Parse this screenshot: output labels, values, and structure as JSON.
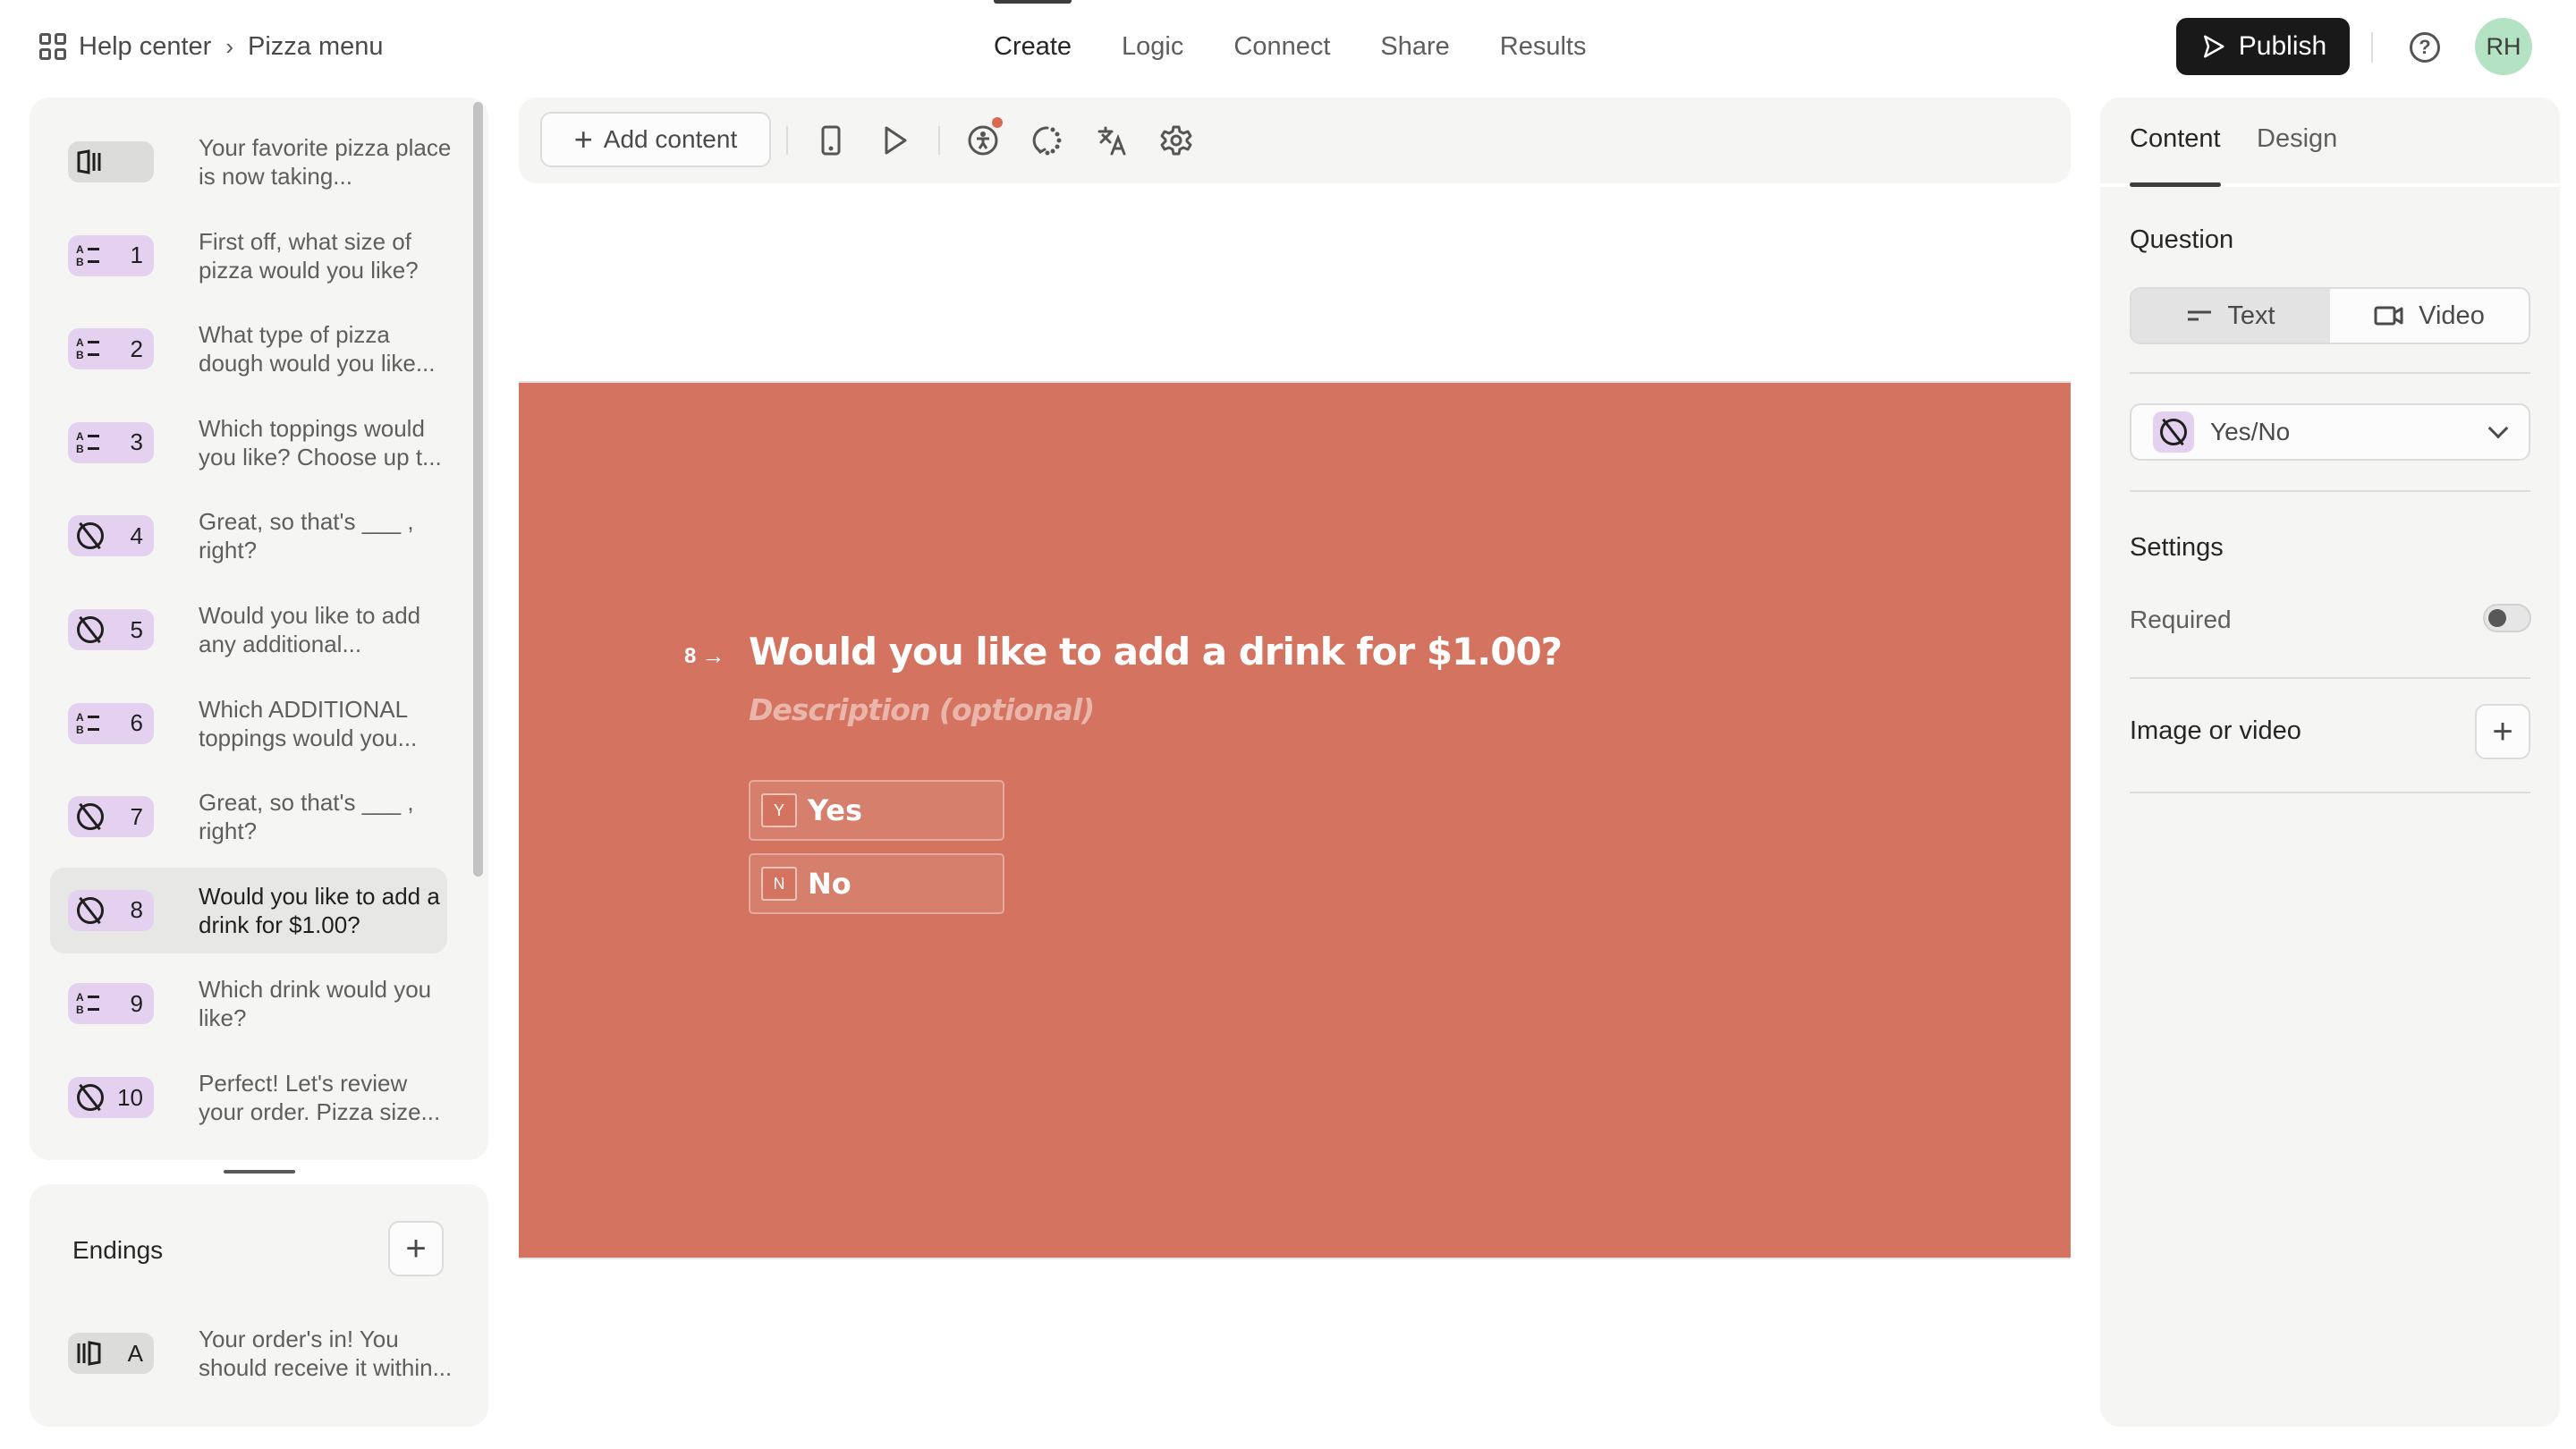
{
  "breadcrumb": {
    "workspace": "Help center",
    "separator": "›",
    "form": "Pizza menu"
  },
  "nav": {
    "tabs": [
      {
        "label": "Create",
        "active": true
      },
      {
        "label": "Logic",
        "active": false
      },
      {
        "label": "Connect",
        "active": false
      },
      {
        "label": "Share",
        "active": false
      },
      {
        "label": "Results",
        "active": false
      }
    ]
  },
  "header": {
    "publish_label": "Publish",
    "help_symbol": "?",
    "avatar_initials": "RH"
  },
  "sidebar": {
    "questions": [
      {
        "type": "welcome",
        "icon": "welcome-screen-icon",
        "number": "",
        "text": "Your favorite pizza place is now taking..."
      },
      {
        "type": "multiple-choice",
        "icon": "multiple-choice-icon",
        "number": "1",
        "text": "First off, what size of pizza would you like?"
      },
      {
        "type": "multiple-choice",
        "icon": "multiple-choice-icon",
        "number": "2",
        "text": "What type of pizza dough would you like..."
      },
      {
        "type": "multiple-choice",
        "icon": "multiple-choice-icon",
        "number": "3",
        "text": "Which toppings would you like? Choose up t..."
      },
      {
        "type": "yes-no",
        "icon": "yes-no-icon",
        "number": "4",
        "text": "Great, so that's ___ , right?"
      },
      {
        "type": "yes-no",
        "icon": "yes-no-icon",
        "number": "5",
        "text": "Would you like to add any additional..."
      },
      {
        "type": "multiple-choice",
        "icon": "multiple-choice-icon",
        "number": "6",
        "text": "Which ADDITIONAL toppings would you..."
      },
      {
        "type": "yes-no",
        "icon": "yes-no-icon",
        "number": "7",
        "text": "Great, so that's ___ , right?"
      },
      {
        "type": "yes-no",
        "icon": "yes-no-icon",
        "number": "8",
        "text": "Would you like to add a drink for $1.00?",
        "active": true
      },
      {
        "type": "multiple-choice",
        "icon": "multiple-choice-icon",
        "number": "9",
        "text": "Which drink would you like?"
      },
      {
        "type": "yes-no",
        "icon": "yes-no-icon",
        "number": "10",
        "text": "Perfect! Let's review your order. Pizza size..."
      }
    ],
    "endings": {
      "title": "Endings",
      "add_symbol": "+",
      "items": [
        {
          "icon": "ending-screen-icon",
          "number": "A",
          "text": "Your order's in! You should receive it within..."
        }
      ]
    }
  },
  "toolbar": {
    "add_content_label": "Add content",
    "add_symbol": "+",
    "icons": [
      "mobile-preview-icon",
      "play-preview-icon",
      "accessibility-icon",
      "history-icon",
      "translate-icon",
      "settings-gear-icon"
    ],
    "accessibility_notification": true
  },
  "canvas": {
    "background_color": "#D37360",
    "question_number": "8",
    "arrow": "→",
    "question_title": "Would you like to add a drink for $1.00?",
    "description_placeholder": "Description (optional)",
    "choices": [
      {
        "key": "Y",
        "label": "Yes"
      },
      {
        "key": "N",
        "label": "No"
      }
    ]
  },
  "right_panel": {
    "tabs": [
      {
        "label": "Content",
        "active": true
      },
      {
        "label": "Design",
        "active": false
      }
    ],
    "question_heading": "Question",
    "question_format": {
      "options": [
        "Text",
        "Video"
      ],
      "selected": "Text"
    },
    "question_type": {
      "selected": "Yes/No"
    },
    "settings_heading": "Settings",
    "required_label": "Required",
    "required_on": false,
    "media_label": "Image or video",
    "media_add_symbol": "+"
  },
  "colors": {
    "accent_dark": "#191919",
    "badge_purple": "#E4D1F0",
    "badge_grey": "#DCDCDB",
    "avatar_green": "#B3E3C2",
    "notification_dot": "#D86A55"
  }
}
